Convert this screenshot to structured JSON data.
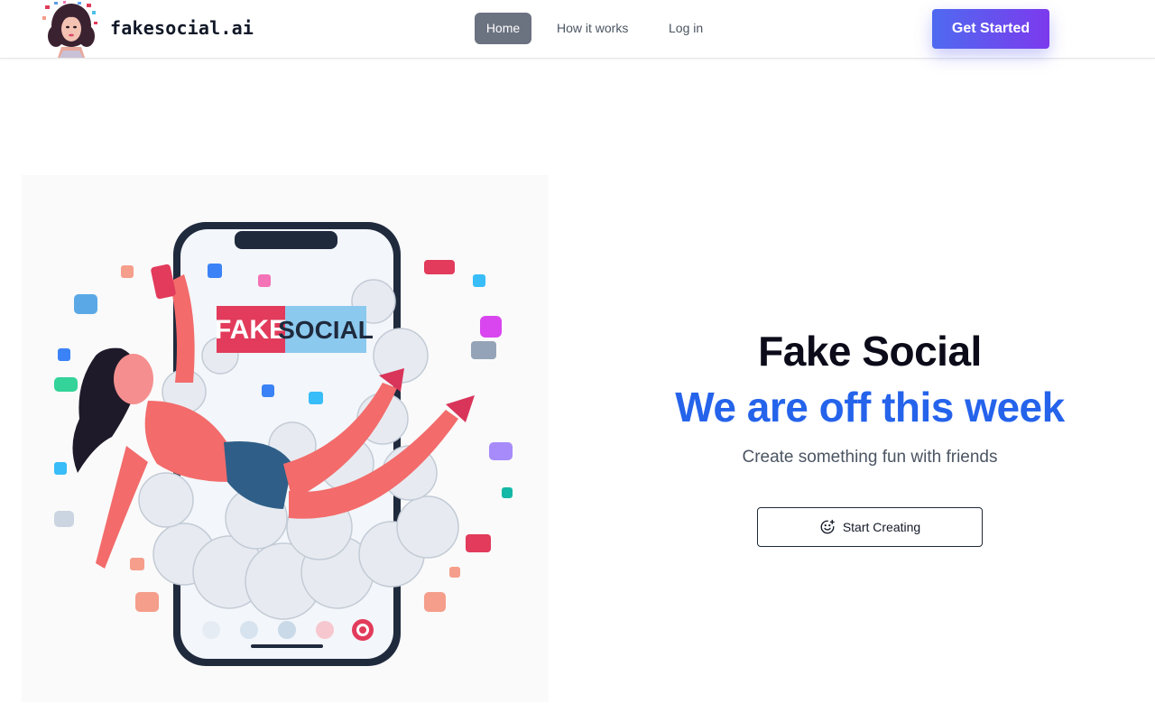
{
  "header": {
    "brand": "fakesocial.ai",
    "logo_icon": "woman-avatar-logo",
    "nav": {
      "home": "Home",
      "how_it_works": "How it works",
      "login": "Log in"
    },
    "cta": "Get Started"
  },
  "hero": {
    "image_icon": "phone-social-illustration",
    "image_logo_text": {
      "fake": "FAKE",
      "social": "SOCIAL"
    },
    "title": "Fake Social",
    "subtitle": "We are off this week",
    "tagline": "Create something fun with friends",
    "button_label": "Start Creating",
    "button_icon": "smile-plus-icon"
  },
  "colors": {
    "accent_blue": "#2563eb",
    "nav_active_bg": "#6b7280",
    "cta_gradient_start": "#4f6af0",
    "cta_gradient_end": "#7c3aed"
  }
}
